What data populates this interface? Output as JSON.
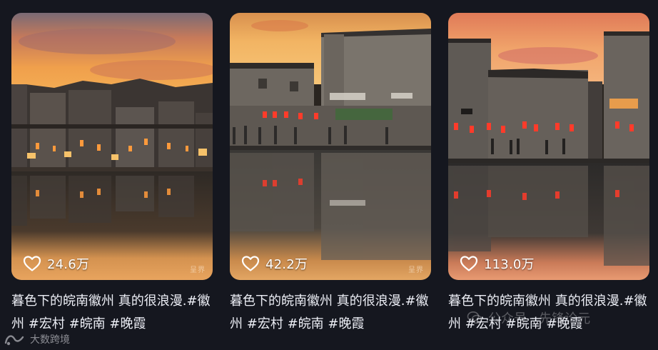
{
  "cards": [
    {
      "likes": "24.6万",
      "title_text": "暮色下的皖南徽州 真的很浪漫.",
      "tags": [
        "#徽州",
        "#宏村",
        "#皖南",
        "#晚霞"
      ],
      "photo_mark": "呈界"
    },
    {
      "likes": "42.2万",
      "title_text": "暮色下的皖南徽州 真的很浪漫.",
      "tags": [
        "#徽州",
        "#宏村",
        "#皖南",
        "#晚霞"
      ],
      "photo_mark": "呈界"
    },
    {
      "likes": "113.0万",
      "title_text": "暮色下的皖南徽州 真的很浪漫.",
      "tags": [
        "#徽州",
        "#宏村",
        "#皖南",
        "#晚霞"
      ],
      "photo_mark": ""
    }
  ],
  "brand_watermark": "大数跨境",
  "overlay_watermark": "公众号 · 先锋论元",
  "icons": {
    "like": "heart-icon",
    "brand": "brand-logo-icon",
    "overlay": "wechat-icon"
  },
  "colors": {
    "background": "#15171f",
    "text": "#eceef5",
    "like_count": "#ffffff"
  }
}
